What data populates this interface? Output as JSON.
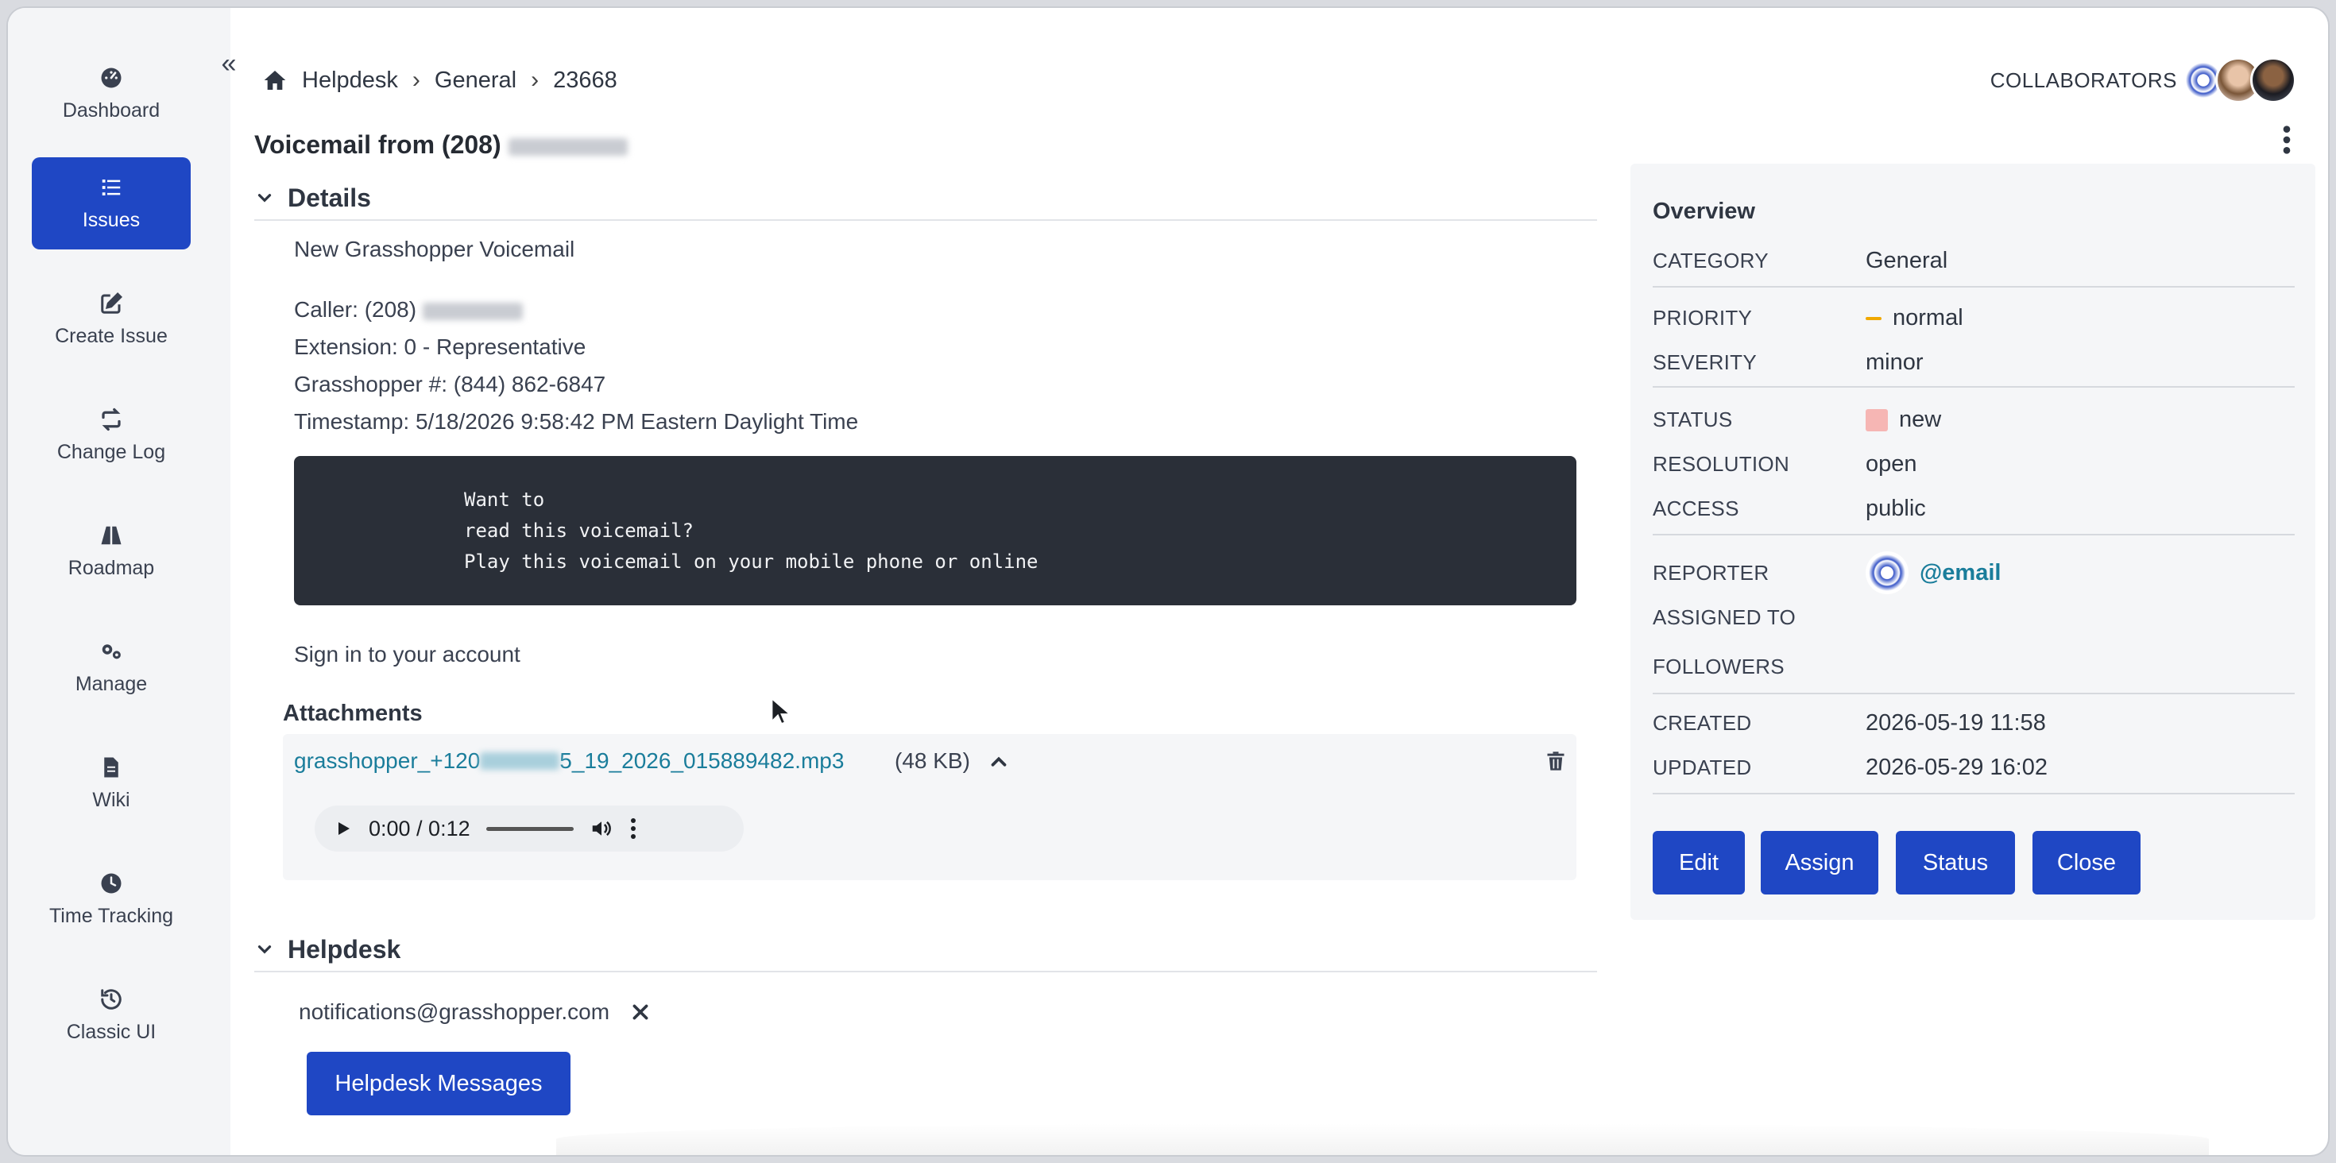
{
  "sidebar": {
    "collapse_glyph": "«",
    "items": [
      {
        "label": "Dashboard",
        "icon": "dashboard-icon"
      },
      {
        "label": "Issues",
        "icon": "list-icon",
        "active": true
      },
      {
        "label": "Create Issue",
        "icon": "edit-icon"
      },
      {
        "label": "Change Log",
        "icon": "sync-icon"
      },
      {
        "label": "Roadmap",
        "icon": "road-icon"
      },
      {
        "label": "Manage",
        "icon": "gears-icon"
      },
      {
        "label": "Wiki",
        "icon": "file-icon"
      },
      {
        "label": "Time Tracking",
        "icon": "clock-icon"
      },
      {
        "label": "Classic UI",
        "icon": "history-icon"
      }
    ]
  },
  "breadcrumb": {
    "items": [
      "Helpdesk",
      "General",
      "23668"
    ]
  },
  "header": {
    "collaborators_label": "COLLABORATORS",
    "title": "Voicemail from (208)"
  },
  "details": {
    "section_title": "Details",
    "subject": "New Grasshopper Voicemail",
    "caller": "Caller: (208)",
    "extension": "Extension: 0 - Representative",
    "grasshopper_number": "Grasshopper #: (844) 862-6847",
    "timestamp": "Timestamp: 5/18/2026 9:58:42 PM Eastern Daylight Time",
    "code_lines": [
      "Want to",
      "read this voicemail?",
      "Play this voicemail on your mobile phone or online"
    ],
    "sign_in": "Sign in to your account"
  },
  "attachments": {
    "title": "Attachments",
    "file_prefix": "grasshopper_+120",
    "file_suffix": "5_19_2026_015889482.mp3",
    "size": "(48 KB)",
    "audio_time": "0:00 / 0:12"
  },
  "helpdesk": {
    "section_title": "Helpdesk",
    "email": "notifications@grasshopper.com",
    "messages_button": "Helpdesk Messages"
  },
  "overview": {
    "title": "Overview",
    "category_label": "CATEGORY",
    "category": "General",
    "priority_label": "PRIORITY",
    "priority": "normal",
    "severity_label": "SEVERITY",
    "severity": "minor",
    "status_label": "STATUS",
    "status": "new",
    "resolution_label": "RESOLUTION",
    "resolution": "open",
    "access_label": "ACCESS",
    "access": "public",
    "reporter_label": "REPORTER",
    "reporter": "@email",
    "assigned_label": "ASSIGNED TO",
    "followers_label": "FOLLOWERS",
    "created_label": "CREATED",
    "created": "2026-05-19 11:58",
    "updated_label": "UPDATED",
    "updated": "2026-05-29 16:02",
    "buttons": {
      "edit": "Edit",
      "assign": "Assign",
      "status": "Status",
      "close": "Close"
    }
  },
  "colors": {
    "primary": "#1f47c4",
    "link": "#1a7d9b",
    "priority_normal": "#f0a800",
    "status_new": "#f6b6b4",
    "code_bg": "#2a2f38"
  }
}
